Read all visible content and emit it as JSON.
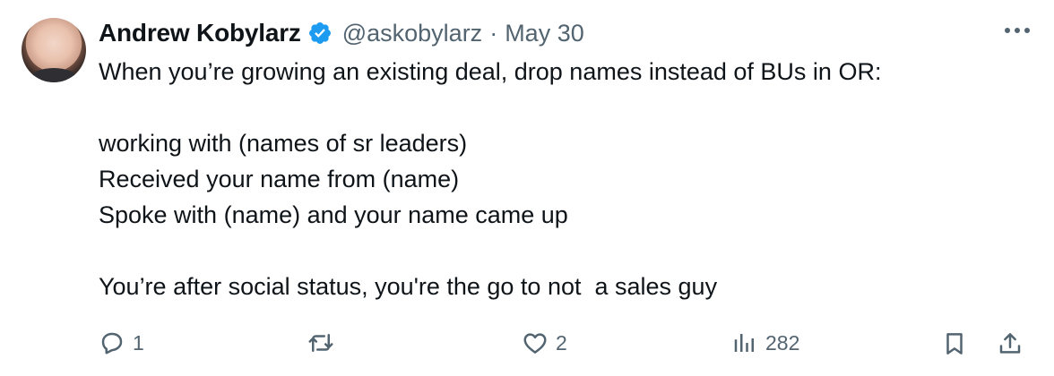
{
  "author": {
    "display_name": "Andrew Kobylarz",
    "handle": "@askobylarz",
    "separator": "·",
    "date": "May 30",
    "verified": true,
    "verified_color": "#1d9bf0"
  },
  "tweet": {
    "text": "When you’re growing an existing deal, drop names instead of BUs in OR:\n\nworking with (names of sr leaders)\nReceived your name from (name)\nSpoke with (name) and your name came up\n\nYou’re after social status, you're the go to not  a sales guy"
  },
  "actions": {
    "reply": {
      "icon": "reply-icon",
      "count": "1"
    },
    "retweet": {
      "icon": "retweet-icon",
      "count": ""
    },
    "like": {
      "icon": "heart-icon",
      "count": "2"
    },
    "views": {
      "icon": "views-icon",
      "count": "282"
    },
    "bookmark": {
      "icon": "bookmark-icon"
    },
    "share": {
      "icon": "share-icon"
    }
  },
  "colors": {
    "text": "#0f1419",
    "secondary": "#536471",
    "accent": "#1d9bf0"
  }
}
